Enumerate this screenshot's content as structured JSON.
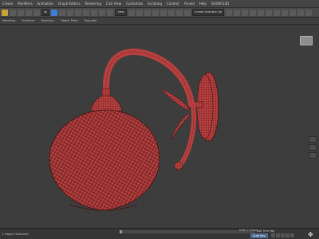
{
  "menubar": {
    "items": [
      "Create",
      "Modifiers",
      "Animation",
      "Graph Editors",
      "Rendering",
      "Civil View",
      "Customize",
      "Scripting",
      "Content",
      "Arnold",
      "Help",
      "SOURCE3D"
    ]
  },
  "toolbar": {
    "filter_dropdown": "All",
    "view_dropdown": "View",
    "selection_set_dropdown": "Create Selection Se"
  },
  "ribbon": {
    "tabs": [
      "Modeling",
      "Freeform",
      "Selection",
      "Object Paint",
      "Populate"
    ]
  },
  "status": {
    "left_text": "1 Object Selected",
    "grid_label": "Grid = 0.0cm",
    "add_time_tag": "Add Time Tag",
    "key_mode": "Auto Key"
  },
  "colors": {
    "mesh_fill": "#b5403f",
    "mesh_wire": "#5a1616",
    "viewport_bg": "#3d3d3d"
  }
}
